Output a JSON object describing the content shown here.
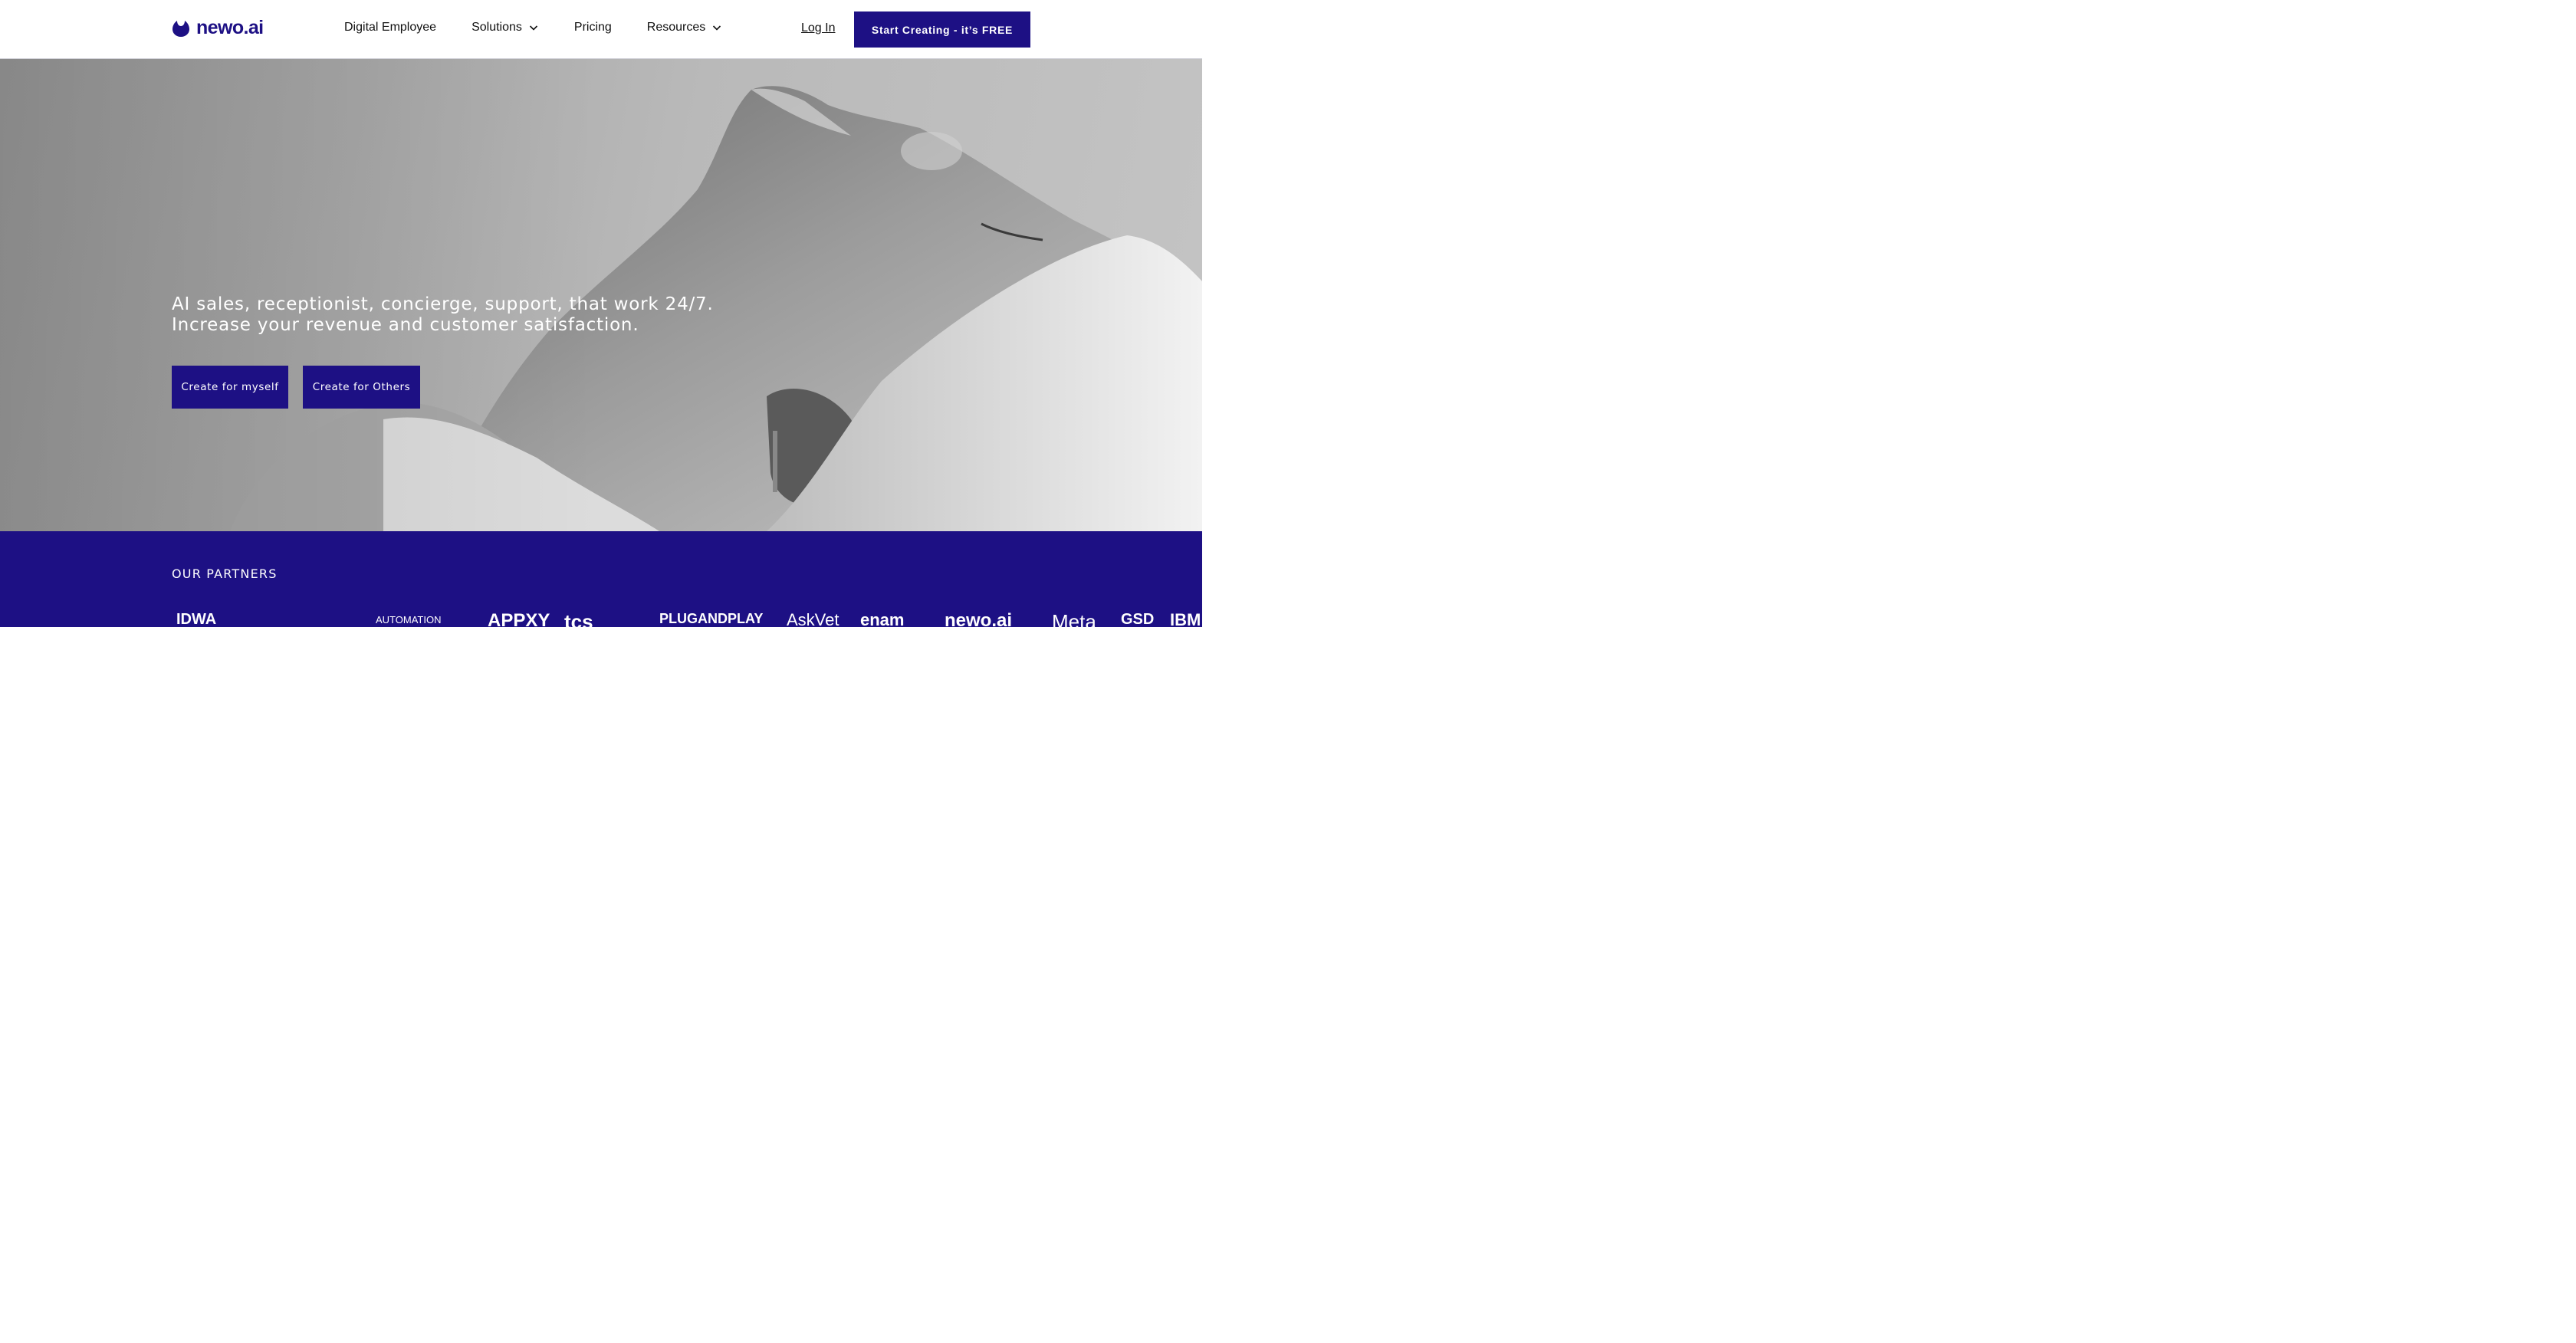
{
  "header": {
    "logo_text": "newo.ai",
    "nav": [
      {
        "label": "Digital Employee",
        "has_dropdown": false
      },
      {
        "label": "Solutions",
        "has_dropdown": true
      },
      {
        "label": "Pricing",
        "has_dropdown": false
      },
      {
        "label": "Resources",
        "has_dropdown": true
      }
    ],
    "login_label": "Log In",
    "cta_label": "Start Creating - it’s FREE"
  },
  "hero": {
    "line1": "AI sales, receptionist, concierge, support, that work 24/7.",
    "line2": "Increase your revenue and customer satisfaction.",
    "btn_myself": "Create for myself",
    "btn_others": "Create for Others"
  },
  "partners": {
    "title": "OUR PARTNERS",
    "logos": [
      "IDWA",
      "AUTOMATION",
      "APPXY",
      "tcs",
      "PLUGANDPLAY",
      "AskVet",
      "enam",
      "newo.ai",
      "Meta",
      "GSD",
      "IBM"
    ]
  },
  "colors": {
    "brand": "#1d1084",
    "white": "#ffffff"
  }
}
